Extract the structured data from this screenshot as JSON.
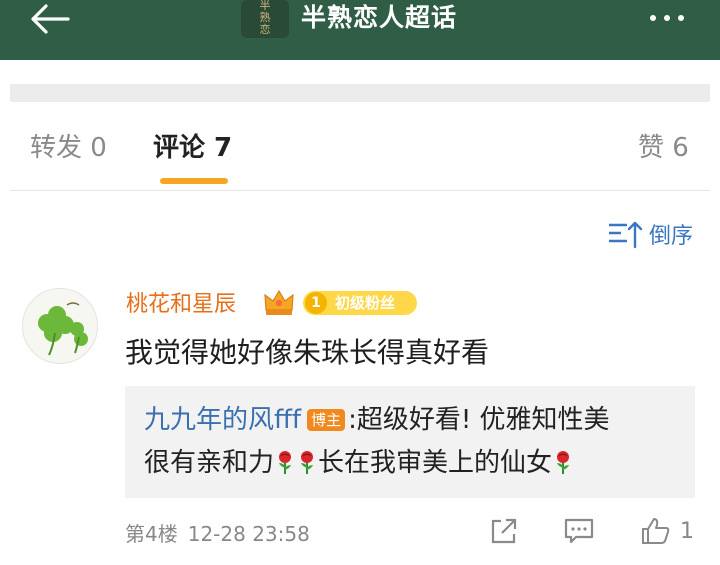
{
  "topbar": {
    "title": "半熟恋人超话",
    "logo_chars": [
      "半",
      "熟",
      "恋",
      "人"
    ]
  },
  "tabs": [
    {
      "label": "转发 0",
      "active": false
    },
    {
      "label": "评论 7",
      "active": true
    },
    {
      "label": "赞 6",
      "active": false
    }
  ],
  "sort": {
    "label": "倒序"
  },
  "comment": {
    "username": "桃花和星辰",
    "fan_badge": {
      "level": "1",
      "label": "初级粉丝"
    },
    "text": "我觉得她好像朱珠长得真好看",
    "reply": {
      "username": "九九年的风fff",
      "author_badge": "博主",
      "text_part1": ":超级好看! 优雅知性美",
      "text_part2_a": "很有亲和力",
      "text_part2_b": "长在我审美上的仙女"
    },
    "floor": "第4楼",
    "timestamp": "12-28 23:58",
    "like_count": "1"
  },
  "colors": {
    "header_bg": "#2f5d45",
    "username": "#e76f1a",
    "link_blue": "#3a6fb0",
    "tab_indicator": "#f6a623",
    "fan_badge": "#ffd84a"
  },
  "icons": [
    "back-arrow-icon",
    "more-icon",
    "sort-icon",
    "crown-icon",
    "rose-icon",
    "share-icon",
    "reply-icon",
    "like-icon"
  ]
}
